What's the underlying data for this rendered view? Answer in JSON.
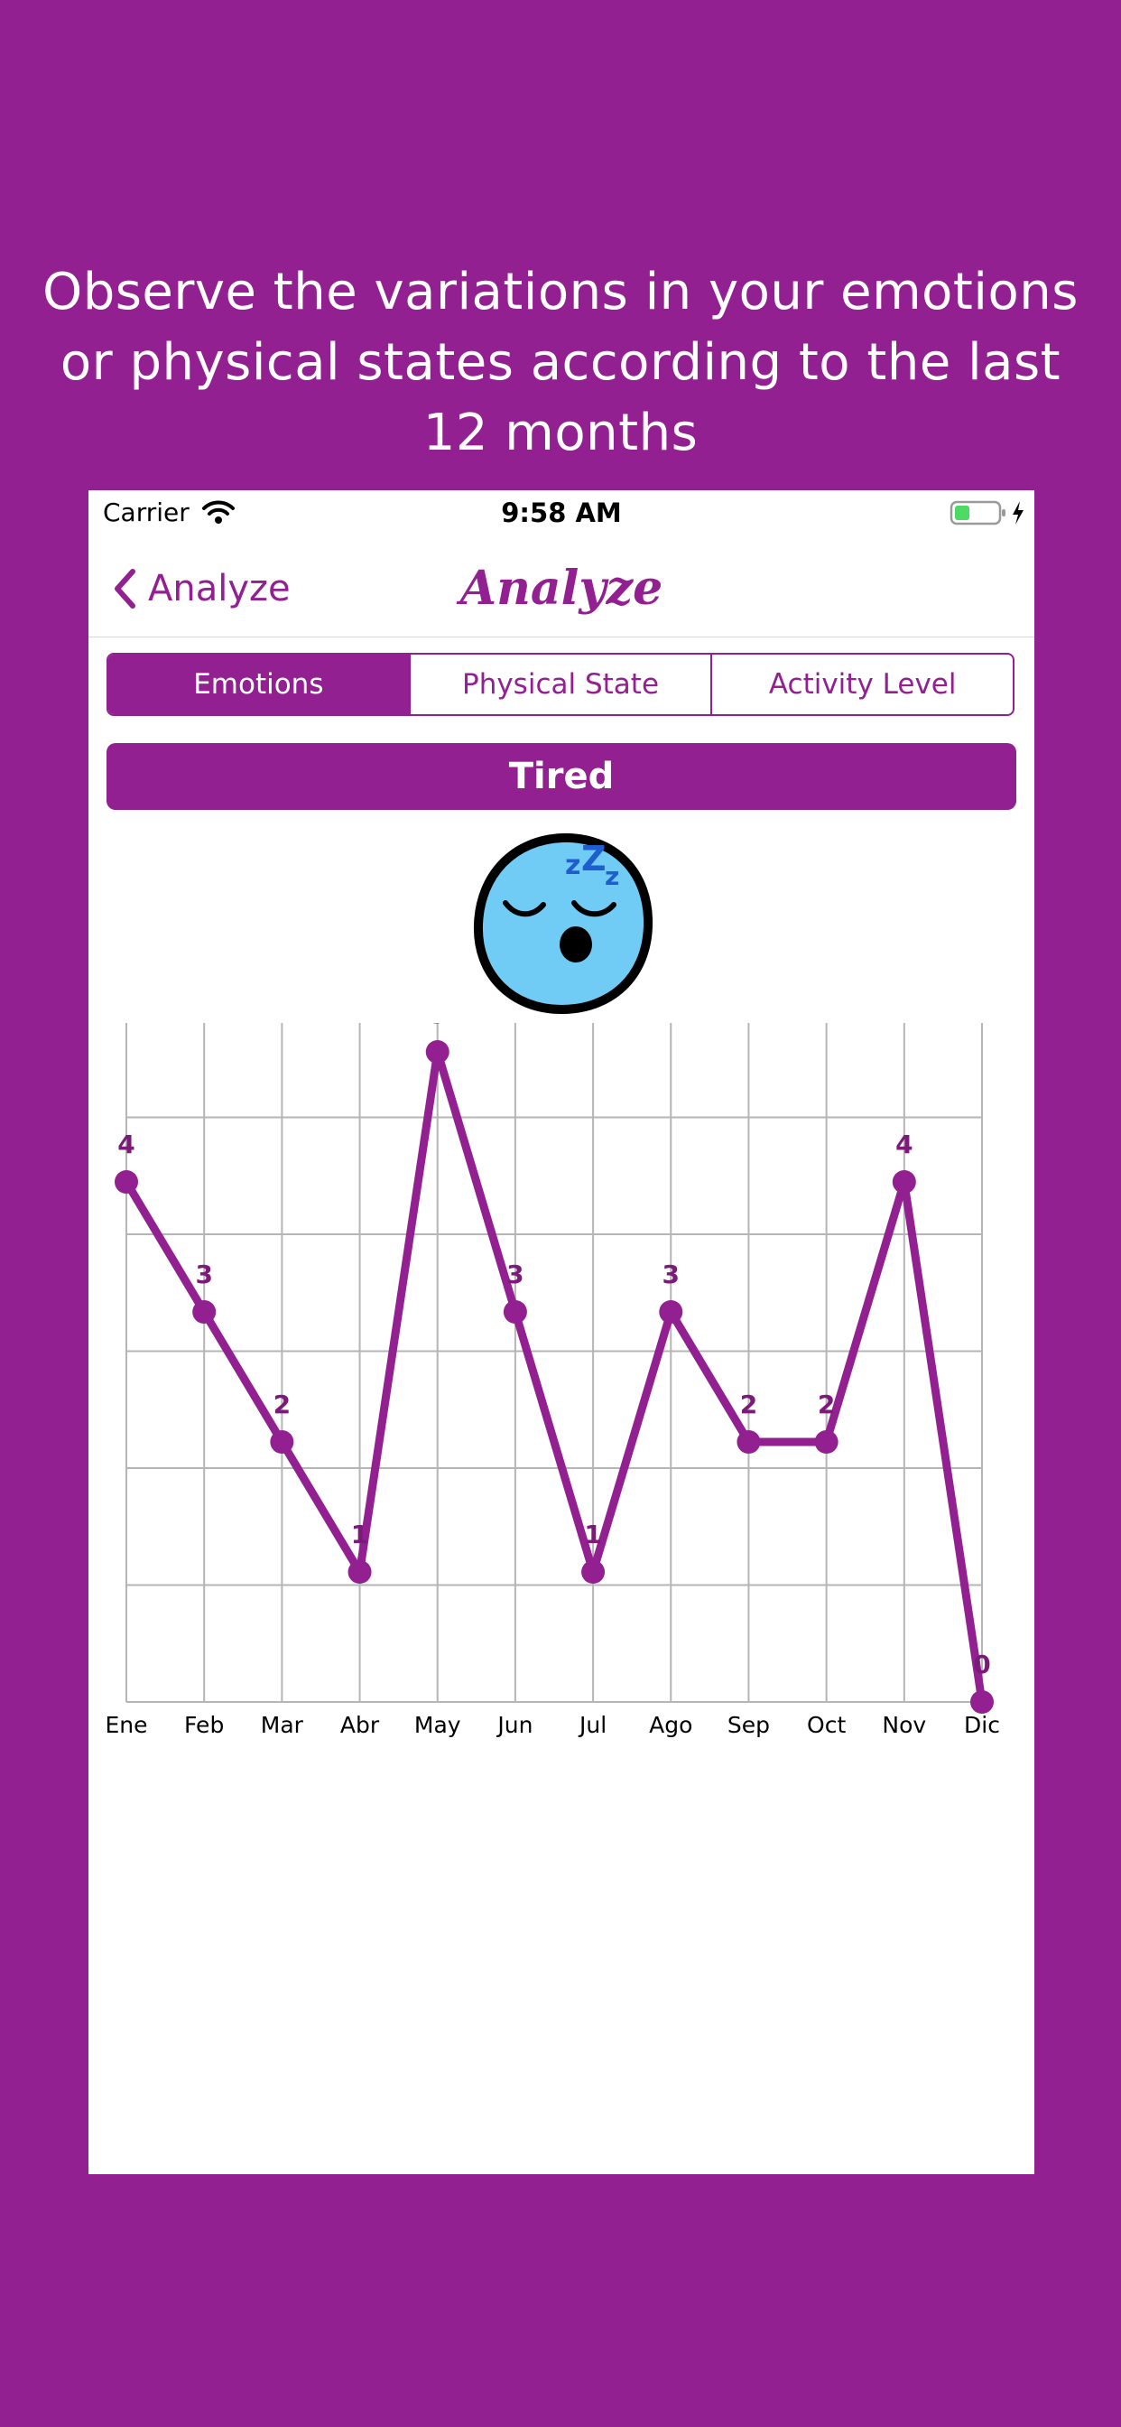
{
  "promo": {
    "headline": "Observe the variations in your emotions or physical states according to the last 12 months"
  },
  "statusbar": {
    "carrier": "Carrier",
    "time": "9:58 AM",
    "battery_color": "#4cd964"
  },
  "navbar": {
    "back_label": "Analyze",
    "title": "Analyze"
  },
  "segments": [
    {
      "label": "Emotions",
      "selected": true
    },
    {
      "label": "Physical State",
      "selected": false
    },
    {
      "label": "Activity Level",
      "selected": false
    }
  ],
  "state_button": {
    "label": "Tired"
  },
  "emotion_icon": "sleeping-face-icon",
  "colors": {
    "accent": "#922090",
    "face_fill": "#70cbf5",
    "zzz": "#1e5ecf"
  },
  "chart_data": {
    "type": "line",
    "categories": [
      "Ene",
      "Feb",
      "Mar",
      "Abr",
      "May",
      "Jun",
      "Jul",
      "Ago",
      "Sep",
      "Oct",
      "Nov",
      "Dic"
    ],
    "values": [
      4,
      3,
      2,
      1,
      5,
      3,
      1,
      3,
      2,
      2,
      4,
      0
    ],
    "ylim": [
      0,
      5.5
    ],
    "grid": true,
    "data_labels": true,
    "title": "",
    "xlabel": "",
    "ylabel": ""
  }
}
